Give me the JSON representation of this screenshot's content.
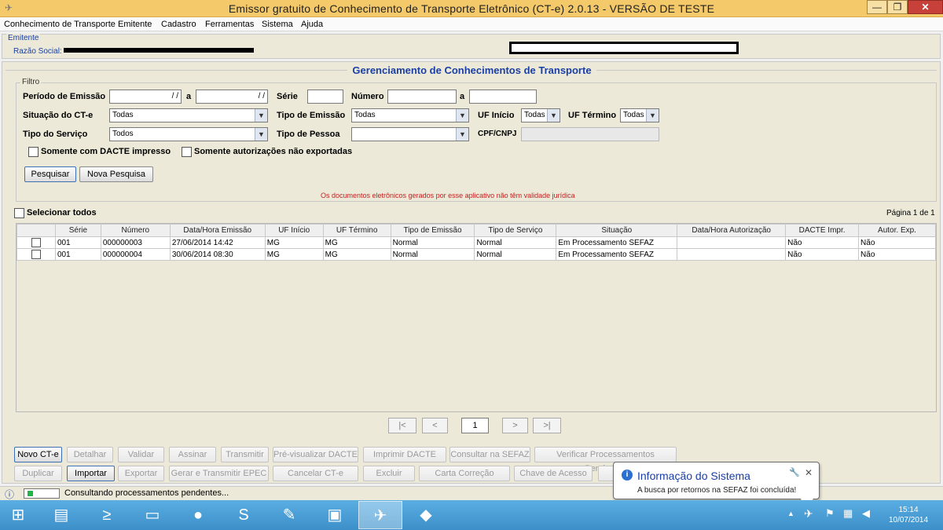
{
  "window": {
    "title": "Emissor gratuito de Conhecimento de Transporte Eletrônico (CT-e) 2.0.13 - VERSÃO DE TESTE",
    "min": "—",
    "max": "❐",
    "close": "✕"
  },
  "menu": [
    "Conhecimento de Transporte",
    "Emitente",
    "Cadastro",
    "Ferramentas",
    "Sistema",
    "Ajuda"
  ],
  "emitente": {
    "legend": "Emitente",
    "razao_social_label": "Razão Social:"
  },
  "main": {
    "heading": "Gerenciamento de Conhecimentos de Transporte",
    "filtro": {
      "legend": "Filtro",
      "periodo_label": "Período de Emissão",
      "periodo_de": "  /  /",
      "a1": "a",
      "periodo_ate": "  /  /",
      "serie_label": "Série",
      "numero_label": "Número",
      "a2": "a",
      "situacao_label": "Situação do CT-e",
      "situacao_value": "Todas",
      "tipo_emissao_label": "Tipo de Emissão",
      "tipo_emissao_value": "Todas",
      "uf_inicio_label": "UF Início",
      "uf_inicio_value": "Todas",
      "uf_termino_label": "UF Término",
      "uf_termino_value": "Todas",
      "tipo_servico_label": "Tipo do Serviço",
      "tipo_servico_value": "Todos",
      "tipo_pessoa_label": "Tipo de Pessoa",
      "tipo_pessoa_value": "",
      "cpf_label": "CPF/CNPJ",
      "chk_dacte": "Somente com DACTE impresso",
      "chk_autorizacoes": "Somente autorizações não exportadas",
      "pesquisar": "Pesquisar",
      "nova_pesquisa": "Nova Pesquisa",
      "warning": "Os documentos eletrônicos gerados por esse aplicativo não têm validade jurídica"
    },
    "selecionar_todos": "Selecionar todos",
    "pagina": "Página 1 de 1"
  },
  "table": {
    "columns": [
      "",
      "Série",
      "Número",
      "Data/Hora Emissão",
      "UF Início",
      "UF Término",
      "Tipo de Emissão",
      "Tipo de Serviço",
      "Situação",
      "Data/Hora Autorização",
      "DACTE Impr.",
      "Autor. Exp."
    ],
    "rows": [
      [
        "",
        "001",
        "000000003",
        "27/06/2014 14:42",
        "MG",
        "MG",
        "Normal",
        "Normal",
        "Em Processamento SEFAZ",
        "",
        "Não",
        "Não"
      ],
      [
        "",
        "001",
        "000000004",
        "30/06/2014 08:30",
        "MG",
        "MG",
        "Normal",
        "Normal",
        "Em Processamento SEFAZ",
        "",
        "Não",
        "Não"
      ]
    ]
  },
  "pagination": {
    "first": "|<",
    "prev": "<",
    "page": "1",
    "next": ">",
    "last": ">|"
  },
  "actions_row1": [
    "Novo CT-e",
    "Detalhar",
    "Validar",
    "Assinar",
    "Transmitir",
    "Pré-visualizar DACTE",
    "Imprimir DACTE",
    "Consultar na SEFAZ",
    "Verificar Processamentos Pendentes"
  ],
  "actions_row2": [
    "Duplicar",
    "Importar",
    "Exportar",
    "Gerar e Transmitir EPEC",
    "Cancelar CT-e",
    "Excluir",
    "Carta Correção",
    "Chave de Acesso"
  ],
  "status": {
    "text": "Consultando processamentos pendentes...",
    "progress": 0.15
  },
  "balloon": {
    "title": "Informação do Sistema",
    "body": "A busca por retornos na SEFAZ foi concluída!"
  },
  "taskbar": {
    "apps": [
      "start-icon",
      "file-manager-icon",
      "powershell-icon",
      "folder-icon",
      "firefox-icon",
      "skype-icon",
      "notepad-icon",
      "pdf-icon",
      "cte-app-icon",
      "notes-icon"
    ],
    "time": "15:14",
    "date": "10/07/2014"
  },
  "colors": {
    "titlebar": "#f4c96a",
    "accent_blue": "#1a3fa5",
    "warning_red": "#c81e1e",
    "taskbar": "#3d8fc9"
  }
}
